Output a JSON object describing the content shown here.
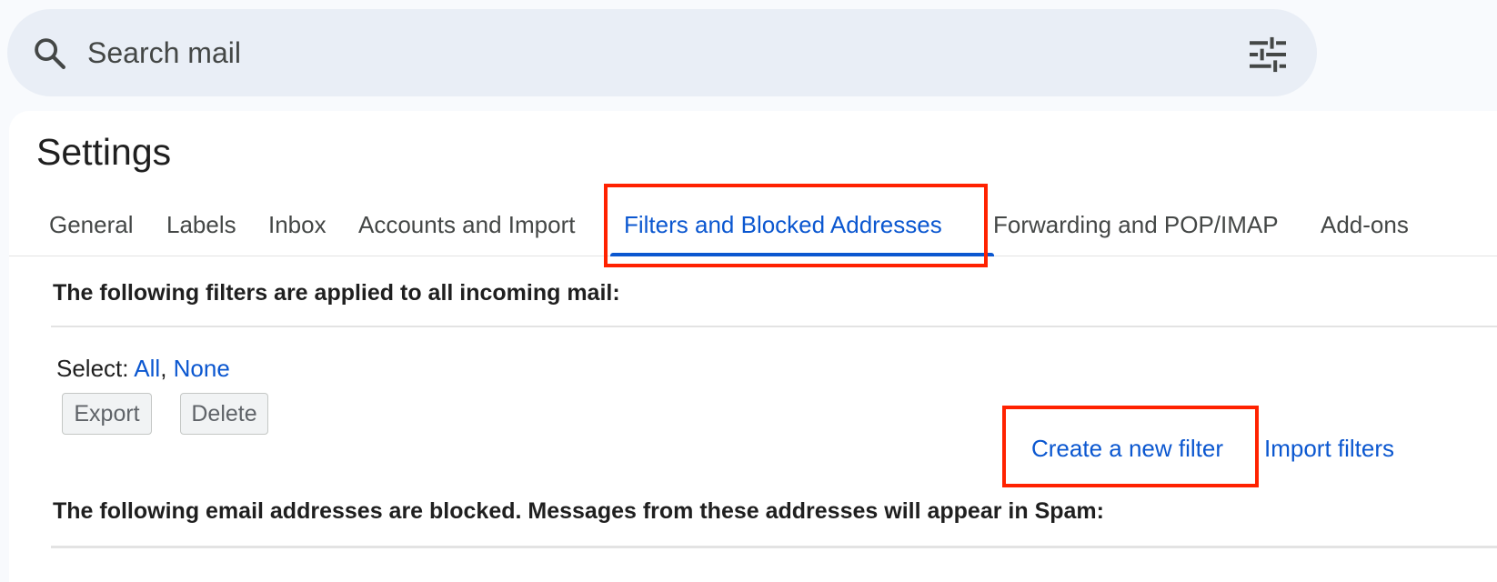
{
  "search": {
    "placeholder": "Search mail"
  },
  "icons": {
    "search": "search-icon",
    "tune": "tune-icon"
  },
  "settings": {
    "title": "Settings",
    "tabs": [
      {
        "label": "General",
        "active": false
      },
      {
        "label": "Labels",
        "active": false
      },
      {
        "label": "Inbox",
        "active": false
      },
      {
        "label": "Accounts and Import",
        "active": false
      },
      {
        "label": "Filters and Blocked Addresses",
        "active": true
      },
      {
        "label": "Forwarding and POP/IMAP",
        "active": false
      },
      {
        "label": "Add-ons",
        "active": false
      }
    ],
    "filters_heading": "The following filters are applied to all incoming mail:",
    "select": {
      "label": "Select: ",
      "all": "All",
      "separator": ", ",
      "none": "None"
    },
    "buttons": {
      "export": "Export",
      "delete": "Delete"
    },
    "create_filter_link": "Create a new filter",
    "import_filters_link": "Import filters",
    "blocked_heading": "The following email addresses are blocked. Messages from these addresses will appear in Spam:"
  },
  "colors": {
    "accent": "#0b57d0",
    "highlight": "#ff2200",
    "search_background": "#e9eef6"
  }
}
